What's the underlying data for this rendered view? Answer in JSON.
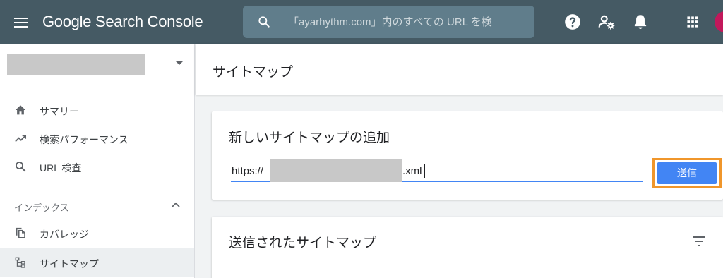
{
  "app": {
    "brand": "Google Search Console"
  },
  "search": {
    "placeholder": "「ayarhythm.com」内のすべての URL を検"
  },
  "topbar_icons": [
    "menu-icon",
    "search-icon",
    "help-icon",
    "manage-users-icon",
    "bell-icon",
    "apps-grid-icon"
  ],
  "sidebar": {
    "nav": [
      {
        "label": "サマリー",
        "icon": "home-icon"
      },
      {
        "label": "検索パフォーマンス",
        "icon": "trending-up-icon"
      },
      {
        "label": "URL 検査",
        "icon": "search-icon"
      }
    ],
    "index_section": {
      "heading": "インデックス",
      "items": [
        {
          "label": "カバレッジ",
          "icon": "copy-icon"
        },
        {
          "label": "サイトマップ",
          "icon": "sitemap-icon",
          "active": true
        }
      ]
    }
  },
  "main": {
    "page_title": "サイトマップ",
    "add_card": {
      "title": "新しいサイトマップの追加",
      "url_prefix": "https://",
      "url_suffix": ".xml",
      "submit_label": "送信"
    },
    "submitted_card": {
      "title": "送信されたサイトマップ"
    }
  },
  "colors": {
    "topbar": "#455a64",
    "search_bg": "#607d8b",
    "primary_button": "#4285f4",
    "highlight_border": "#f0962b",
    "avatar": "#c2185b",
    "active_nav_bg": "#eceff1"
  }
}
